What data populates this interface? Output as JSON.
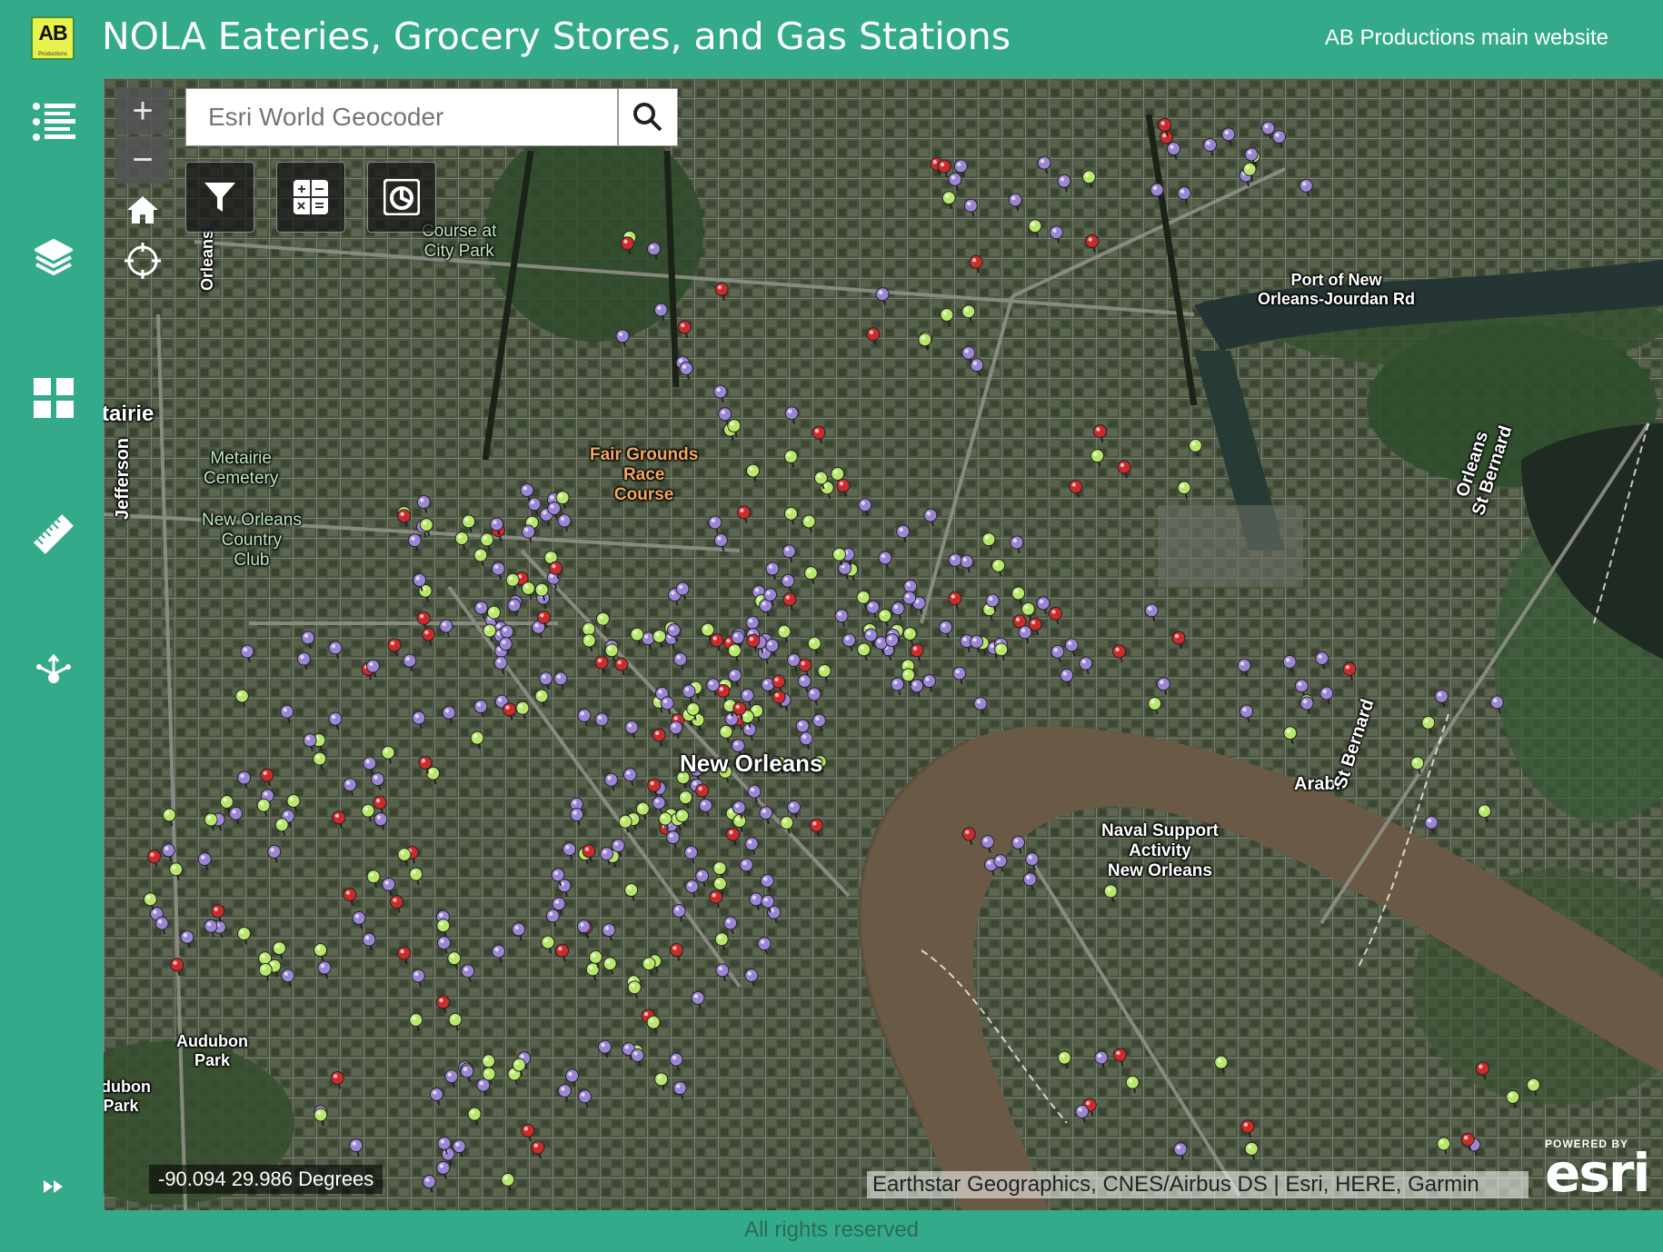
{
  "header": {
    "logo_text": "AB",
    "logo_subtext": "Productions",
    "title": "NOLA Eateries, Grocery Stores, and Gas Stations",
    "link": "AB Productions main website"
  },
  "sidebar": {
    "items": [
      {
        "name": "legend",
        "icon": "list-icon"
      },
      {
        "name": "layers",
        "icon": "layers-icon"
      },
      {
        "name": "basemap",
        "icon": "grid-icon"
      },
      {
        "name": "measure",
        "icon": "ruler-icon"
      },
      {
        "name": "share",
        "icon": "share-icon"
      }
    ],
    "expand_icon": "double-chevron-right-icon"
  },
  "map": {
    "zoom_in": "+",
    "zoom_out": "−",
    "search": {
      "placeholder": "Esri World Geocoder"
    },
    "tools": [
      {
        "name": "filter",
        "icon": "filter-icon"
      },
      {
        "name": "calculator",
        "icon": "calculator-icon"
      },
      {
        "name": "chart",
        "icon": "pie-chart-icon"
      }
    ],
    "labels": {
      "course": "Course at\nCity Park",
      "port": "Port of New\nOrleans-Jourdan Rd",
      "metairie_partial": "tairie",
      "jefferson": "Jefferson",
      "orleans_top": "Orleans",
      "metairie_cemetery": "Metairie\nCemetery",
      "nola_country_club": "New Orleans\nCountry\nClub",
      "fair_grounds": "Fair Grounds\nRace\nCourse",
      "new_orleans": "New Orleans",
      "naval": "Naval Support\nActivity\nNew Orleans",
      "arabi": "Arabi",
      "st_bernard_1": "St Bernard",
      "orleans_st_bernard": "Orleans\nSt Bernard",
      "audubon": "Audubon\nPark",
      "audubon_partial": "udubon\nPark"
    },
    "coordinates": "-90.094 29.986 Degrees",
    "attribution": "Earthstar Geographics, CNES/Airbus DS | Esri, HERE, Garmin",
    "powered_by": "POWERED BY",
    "esri": "esri",
    "colors": {
      "eatery": "#9b86d6",
      "grocery": "#b8e86a",
      "gas": "#cc2b2b"
    }
  },
  "footer": {
    "text": "All rights reserved"
  }
}
